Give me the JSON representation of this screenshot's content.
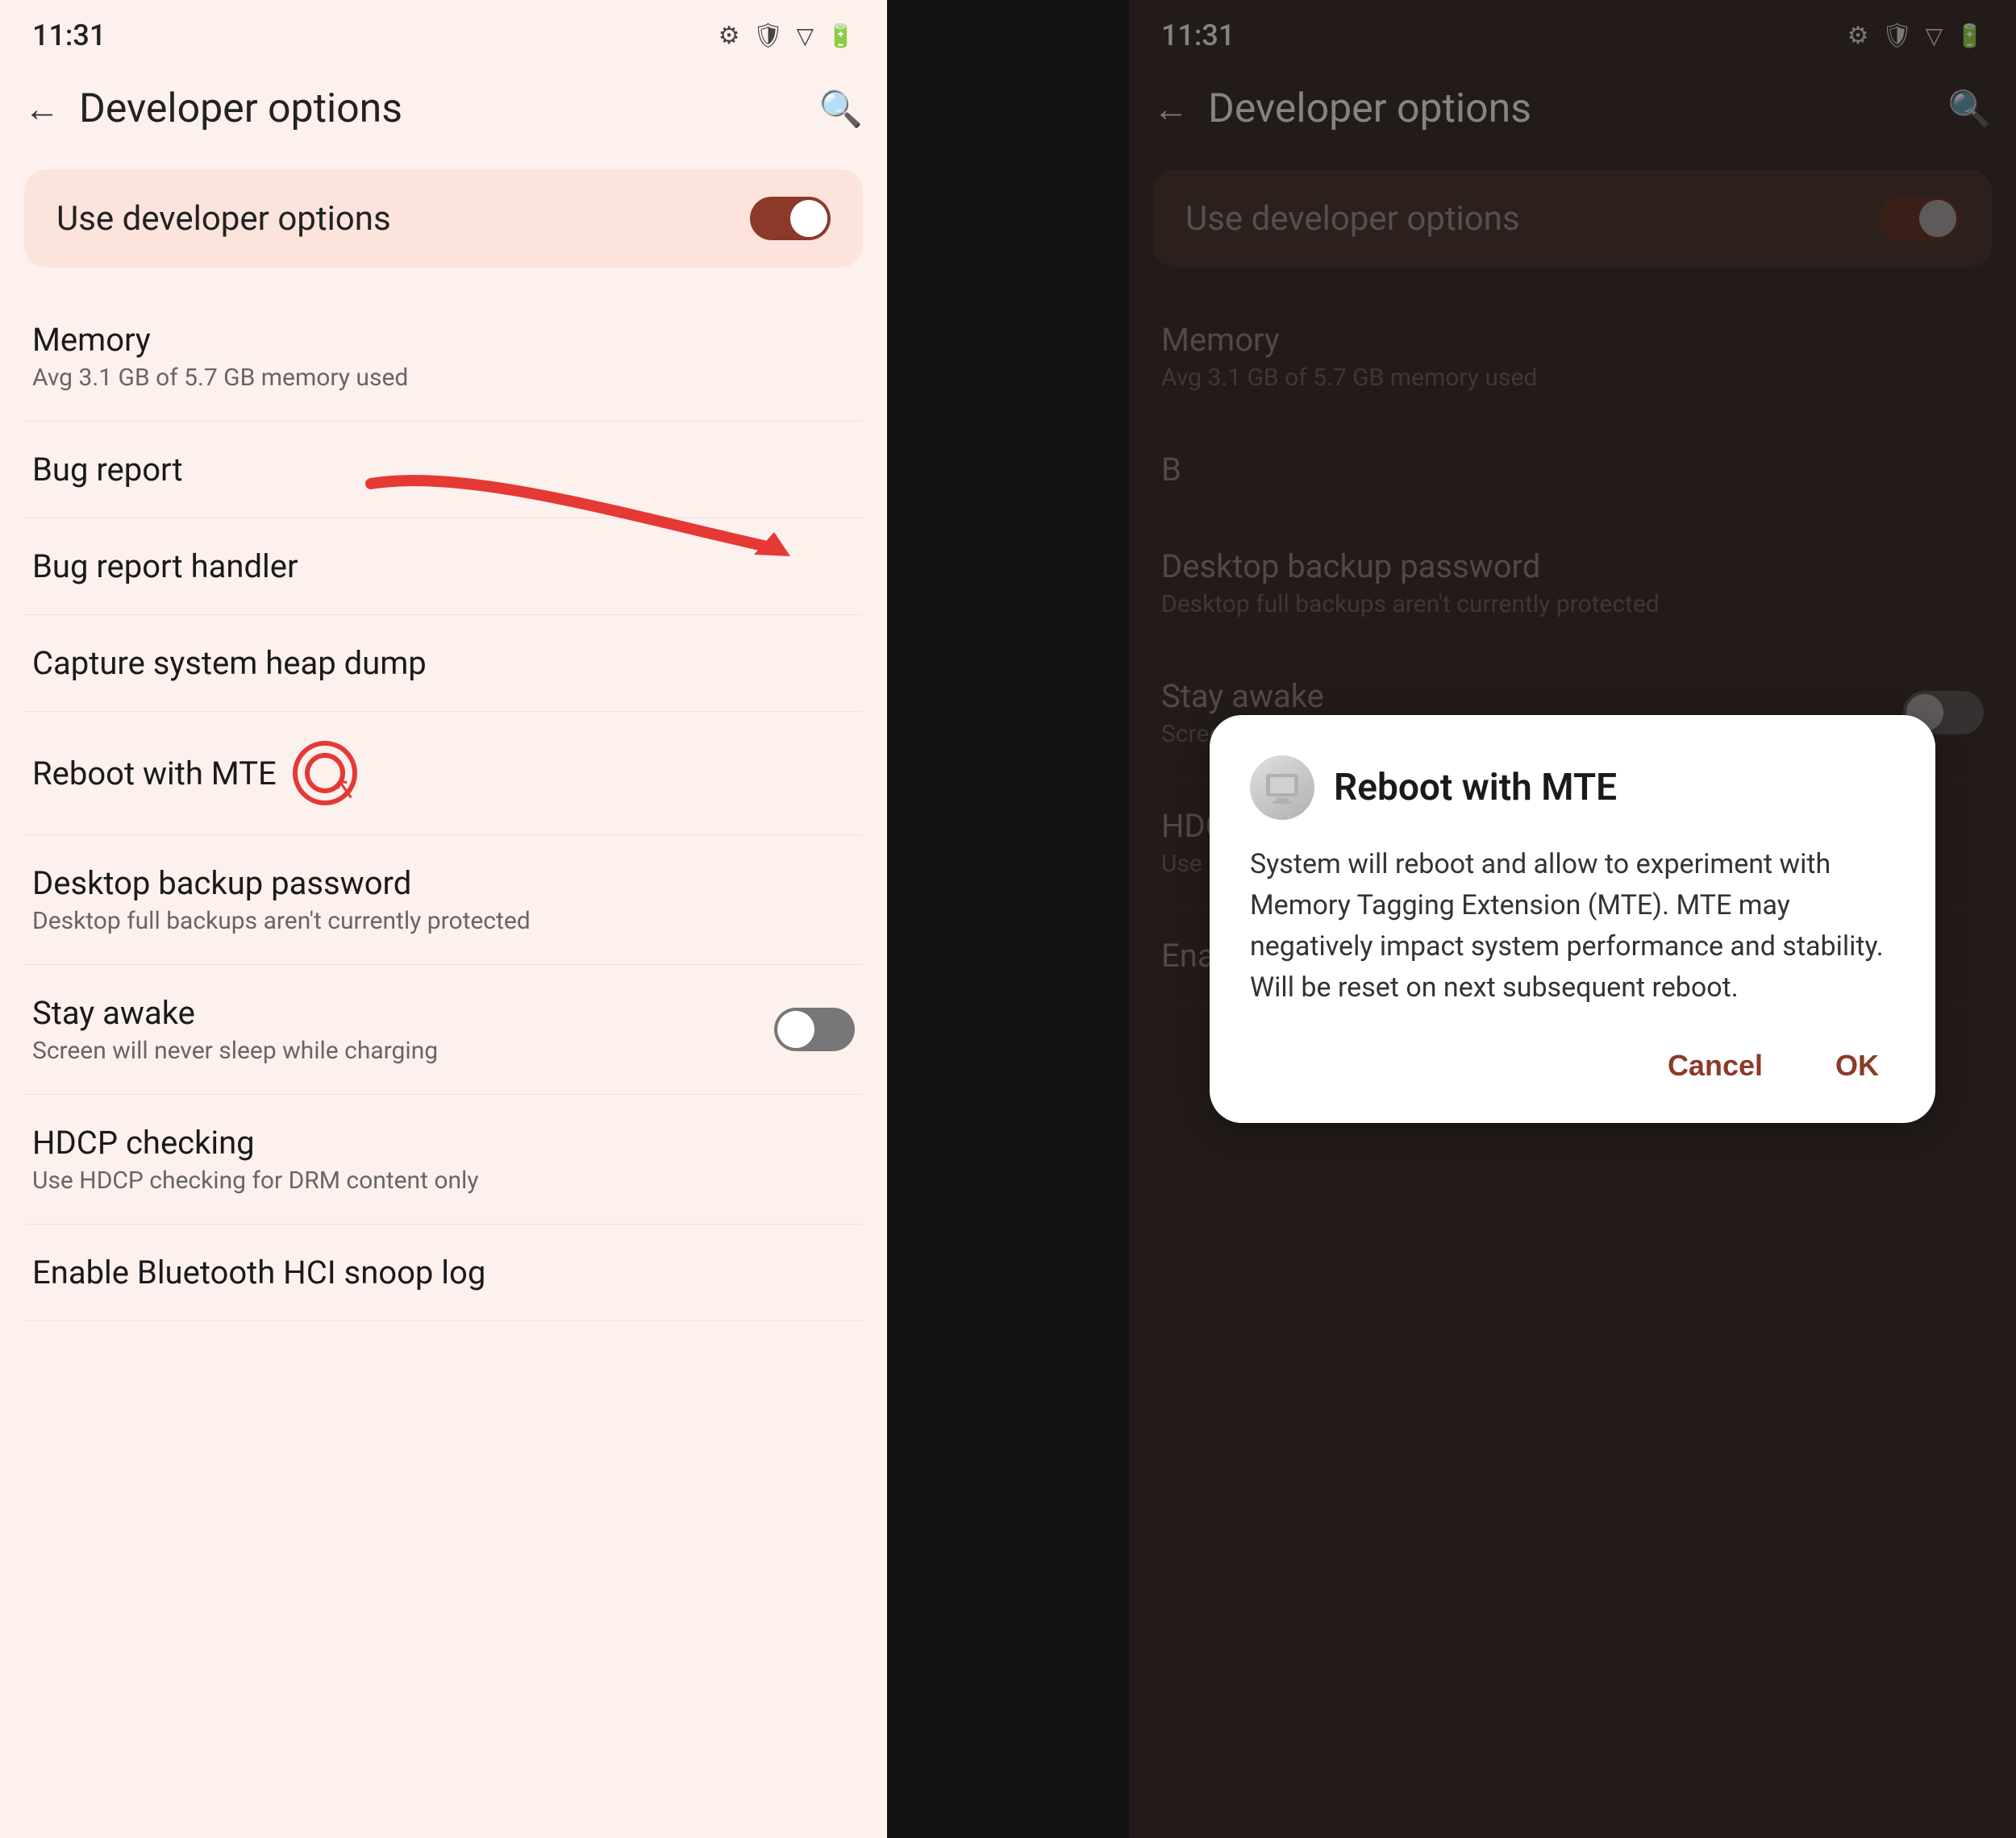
{
  "left": {
    "status": {
      "time": "11:31",
      "icons": [
        "⚙",
        "🛡",
        "▽"
      ]
    },
    "header": {
      "title": "Developer options",
      "back_label": "←",
      "search_label": "🔍"
    },
    "toggle_section": {
      "label": "Use developer options",
      "toggle_state": "on"
    },
    "items": [
      {
        "title": "Memory",
        "subtitle": "Avg 3.1 GB of 5.7 GB memory used",
        "has_toggle": false
      },
      {
        "title": "Bug report",
        "subtitle": "",
        "has_toggle": false
      },
      {
        "title": "Bug report handler",
        "subtitle": "",
        "has_toggle": false
      },
      {
        "title": "Capture system heap dump",
        "subtitle": "",
        "has_toggle": false
      },
      {
        "title": "Reboot with MTE",
        "subtitle": "",
        "has_toggle": false,
        "has_indicator": true
      },
      {
        "title": "Desktop backup password",
        "subtitle": "Desktop full backups aren't currently protected",
        "has_toggle": false
      },
      {
        "title": "Stay awake",
        "subtitle": "Screen will never sleep while charging",
        "has_toggle": true,
        "toggle_state": "off"
      },
      {
        "title": "HDCP checking",
        "subtitle": "Use HDCP checking for DRM content only",
        "has_toggle": false
      },
      {
        "title": "Enable Bluetooth HCI snoop log",
        "subtitle": "",
        "has_toggle": false
      }
    ]
  },
  "right": {
    "status": {
      "time": "11:31",
      "icons": [
        "⚙",
        "🛡",
        "▽"
      ]
    },
    "header": {
      "title": "Developer options",
      "back_label": "←",
      "search_label": "🔍"
    },
    "toggle_section": {
      "label": "Use developer options",
      "toggle_state": "on"
    },
    "items": [
      {
        "title": "Memory",
        "subtitle": "Avg 3.1 GB of 5.7 GB memory used",
        "has_toggle": false
      },
      {
        "title": "B",
        "subtitle": "",
        "has_toggle": false,
        "partial": true
      },
      {
        "title": "Desktop backup password",
        "subtitle": "Desktop full backups aren't currently protected",
        "has_toggle": false
      },
      {
        "title": "Stay awake",
        "subtitle": "Screen will never sleep while charging",
        "has_toggle": true,
        "toggle_state": "off"
      },
      {
        "title": "HDCP checking",
        "subtitle": "Use HDCP checking for DRM content only",
        "has_toggle": false
      },
      {
        "title": "Enable Bluetooth HCI snoop log",
        "subtitle": "",
        "has_toggle": false
      }
    ],
    "dialog": {
      "title": "Reboot with MTE",
      "icon": "💿",
      "message": "System will reboot and allow to experiment with Memory Tagging Extension (MTE). MTE may negatively impact system performance and stability. Will be reset on next subsequent reboot.",
      "cancel_label": "Cancel",
      "ok_label": "OK"
    }
  }
}
